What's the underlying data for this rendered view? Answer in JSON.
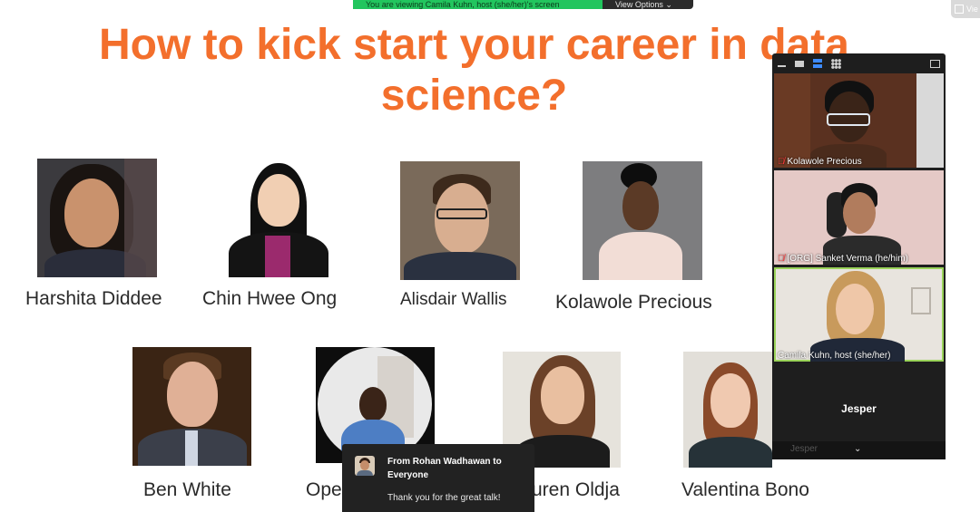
{
  "share_bar": {
    "status": "You are viewing Camila Kuhn, host (she/her)'s screen",
    "view_options": "View Options"
  },
  "top_right_button": {
    "label": "Vie"
  },
  "slide": {
    "title": "How to kick start your career in data science?",
    "title_color": "#f36f2c",
    "speakers": [
      {
        "name": "Harshita Diddee"
      },
      {
        "name": "Chin Hwee Ong"
      },
      {
        "name": "Alisdair Wallis"
      },
      {
        "name": "Kolawole Precious"
      },
      {
        "name": "Ben White"
      },
      {
        "name": "Ope"
      },
      {
        "name": "uren Oldja"
      },
      {
        "name": "Valentina Bono"
      }
    ]
  },
  "zoom_panel": {
    "tiles": [
      {
        "label": "Kolawole Precious",
        "muted": true
      },
      {
        "label": "[ORG] Sanket Verma (he/him)",
        "muted": true
      },
      {
        "label": "Camila Kuhn, host (she/her)",
        "muted": false
      }
    ],
    "no_video_name": "Jesper",
    "bottom_label": "Jesper",
    "active_speaker_border": "#9bd35a"
  },
  "chat": {
    "from": "From Rohan Wadhawan to Everyone",
    "message": "Thank you for the great talk!"
  }
}
